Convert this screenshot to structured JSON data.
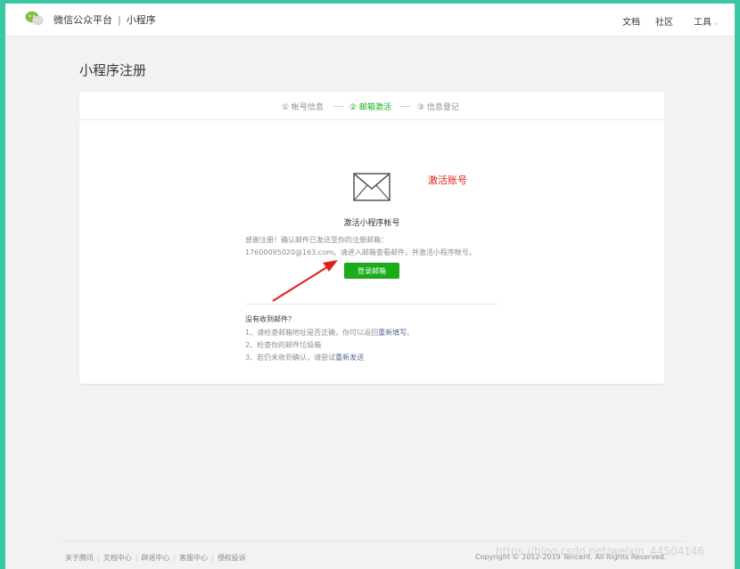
{
  "header": {
    "brand": "微信公众平台",
    "separator": "|",
    "product": "小程序",
    "nav": {
      "docs": "文档",
      "community": "社区",
      "tools": "工具"
    }
  },
  "page": {
    "title": "小程序注册"
  },
  "steps": [
    {
      "label": "① 帐号信息",
      "active": false
    },
    {
      "label": "② 邮箱激活",
      "active": true
    },
    {
      "label": "③ 信息登记",
      "active": false
    }
  ],
  "activation": {
    "annotation": "激活账号",
    "title": "激活小程序帐号",
    "line1": "感谢注册！确认邮件已发送至你的注册邮箱：",
    "line2": "17600095020@163.com。请进入邮箱查看邮件，并激活小程序帐号。",
    "button": "登录邮箱"
  },
  "help": {
    "title": "没有收到邮件？",
    "item1_prefix": "1、请检查邮箱地址是否正确，你可以返回",
    "item1_link": "重新填写",
    "item1_suffix": "。",
    "item2": "2、检查你的邮件垃圾箱",
    "item3_prefix": "3、若仍未收到确认，请尝试",
    "item3_link": "重新发送"
  },
  "footer": {
    "links": [
      "关于腾讯",
      "文档中心",
      "辟谣中心",
      "客服中心",
      "侵权投诉"
    ],
    "copyright": "Copyright © 2012-2019 Tencent. All Rights Reserved.",
    "watermark": "https://blog.csdn.net/weixin_44504146"
  },
  "colors": {
    "accent": "#1aad19",
    "link": "#576b95",
    "annotation": "#e0201b",
    "frame": "#39c7a5"
  }
}
